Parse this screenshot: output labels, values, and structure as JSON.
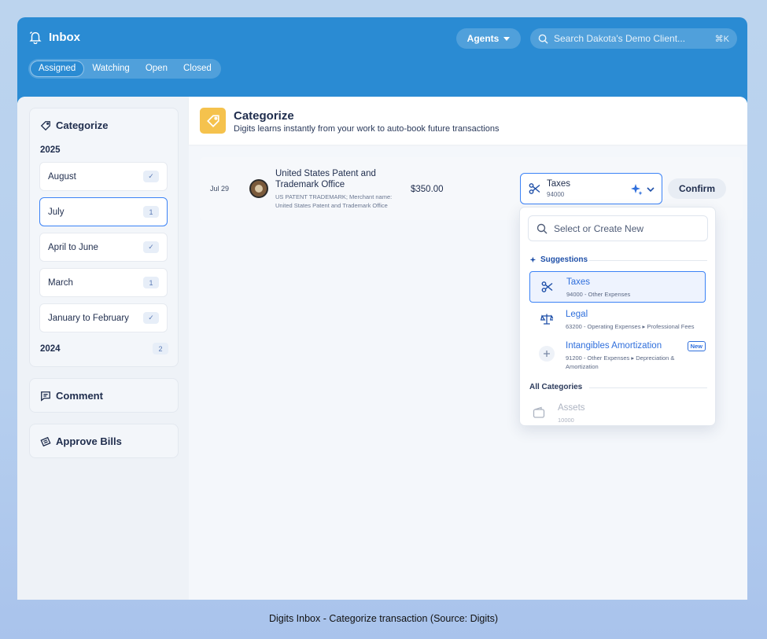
{
  "colors": {
    "brand": "#2a8bd3",
    "accent": "#3b82f6",
    "highlight": "#f5c24d"
  },
  "header": {
    "title": "Inbox",
    "tabs": [
      {
        "label": "Assigned",
        "active": true
      },
      {
        "label": "Watching"
      },
      {
        "label": "Open"
      },
      {
        "label": "Closed"
      }
    ],
    "agents_label": "Agents",
    "search_placeholder": "Search Dakota's Demo Client...",
    "search_shortcut": "⌘K"
  },
  "sidebar": {
    "categorize": {
      "title": "Categorize",
      "year_2025": "2025",
      "months": [
        {
          "label": "August",
          "badge": "✓"
        },
        {
          "label": "July",
          "badge": "1"
        },
        {
          "label": "April to June",
          "badge": "✓"
        },
        {
          "label": "March",
          "badge": "1"
        },
        {
          "label": "January to February",
          "badge": "✓"
        }
      ],
      "year_2024": "2024",
      "year_2024_badge": "2"
    },
    "comment": "Comment",
    "approve_bills": "Approve Bills"
  },
  "main": {
    "title": "Categorize",
    "subtitle": "Digits learns instantly from your work to auto-book future transactions",
    "transaction": {
      "date": "Jul 29",
      "name": "United States Patent and Trademark Office",
      "description": "US PATENT TRADEMARK; Merchant name: United States Patent and Trademark Office",
      "amount": "$350.00",
      "category": "Taxes",
      "category_code": "94000",
      "confirm_label": "Confirm"
    },
    "dropdown": {
      "search_placeholder": "Select or Create New",
      "suggestions_label": "Suggestions",
      "suggestions": [
        {
          "name": "Taxes",
          "path": "94000 - Other Expenses",
          "icon": "scissors-icon"
        },
        {
          "name": "Legal",
          "path": "63200 - Operating Expenses ▸ Professional Fees",
          "icon": "scales-icon"
        },
        {
          "name": "Intangibles Amortization",
          "path": "91200 - Other Expenses ▸ Depreciation & Amortization",
          "icon": "plus-icon",
          "badge": "New"
        }
      ],
      "all_categories_label": "All Categories",
      "all_categories": [
        {
          "name": "Assets",
          "code": "10000",
          "icon": "wallet-icon"
        }
      ]
    }
  },
  "caption": "Digits Inbox - Categorize transaction (Source: Digits)"
}
